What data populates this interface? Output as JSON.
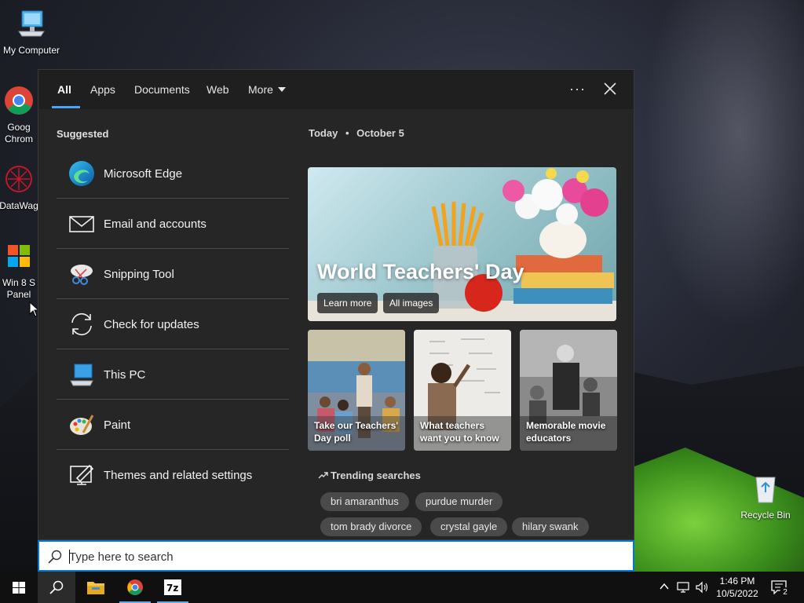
{
  "desktop": {
    "icons": [
      {
        "label": "My Computer"
      },
      {
        "label": "Goog Chrom"
      },
      {
        "label": "DataWag"
      },
      {
        "label": "Win 8 S Panel"
      },
      {
        "label": "Recycle Bin"
      }
    ]
  },
  "search_panel": {
    "tabs": [
      {
        "label": "All",
        "active": true
      },
      {
        "label": "Apps"
      },
      {
        "label": "Documents"
      },
      {
        "label": "Web"
      },
      {
        "label": "More"
      }
    ],
    "more_options_label": "···",
    "suggested": {
      "title": "Suggested",
      "items": [
        {
          "label": "Microsoft Edge",
          "icon": "edge-icon"
        },
        {
          "label": "Email and accounts",
          "icon": "mail-icon"
        },
        {
          "label": "Snipping Tool",
          "icon": "snipping-tool-icon"
        },
        {
          "label": "Check for updates",
          "icon": "sync-icon"
        },
        {
          "label": "This PC",
          "icon": "this-pc-icon"
        },
        {
          "label": "Paint",
          "icon": "paint-icon"
        },
        {
          "label": "Themes and related settings",
          "icon": "themes-icon"
        }
      ]
    },
    "today": {
      "label": "Today",
      "separator": "•",
      "date": "October 5"
    },
    "hero": {
      "title": "World Teachers' Day",
      "learn_more": "Learn more",
      "all_images": "All images"
    },
    "cards": [
      {
        "text": "Take our Teachers' Day poll"
      },
      {
        "text": "What teachers want you to know"
      },
      {
        "text": "Memorable movie educators"
      }
    ],
    "trending": {
      "title": "Trending searches",
      "chips": [
        "bri amaranthus",
        "purdue murder",
        "tom brady divorce",
        "crystal gayle",
        "hilary swank"
      ]
    }
  },
  "searchbox": {
    "placeholder": "Type here to search"
  },
  "taskbar": {
    "clock_time": "1:46 PM",
    "clock_date": "10/5/2022",
    "notification_count": "2"
  },
  "colors": {
    "accent": "#0078d4",
    "tab_underline": "#4aa3f5",
    "panel_bg": "#262626"
  }
}
